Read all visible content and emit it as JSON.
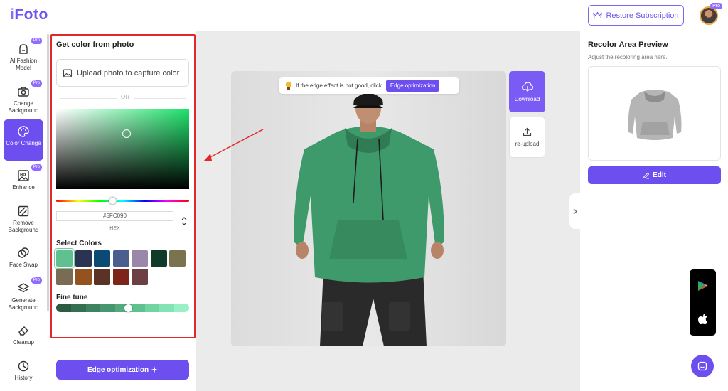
{
  "header": {
    "logo": "iFoto",
    "restore_button": "Restore Subscription",
    "avatar_badge": "Pro"
  },
  "nav": {
    "items": [
      {
        "label": "AI Fashion Model",
        "icon": "hanger-icon",
        "pro": "Pro",
        "active": false
      },
      {
        "label": "Change Background",
        "icon": "camera-icon",
        "pro": "Pro",
        "active": false
      },
      {
        "label": "Color Change",
        "icon": "palette-icon",
        "pro": "",
        "active": true
      },
      {
        "label": "Enhance",
        "icon": "hd-image-icon",
        "pro": "Pro",
        "active": false
      },
      {
        "label": "Remove Background",
        "icon": "slash-square-icon",
        "pro": "",
        "active": false
      },
      {
        "label": "Face Swap",
        "icon": "face-swap-icon",
        "pro": "",
        "active": false
      },
      {
        "label": "Generate Background",
        "icon": "layers-icon",
        "pro": "Pro",
        "active": false
      },
      {
        "label": "Cleanup",
        "icon": "eraser-icon",
        "pro": "",
        "active": false
      },
      {
        "label": "History",
        "icon": "clock-icon",
        "pro": "",
        "active": false
      }
    ]
  },
  "panel": {
    "title": "Get color from photo",
    "upload_label": "Upload photo to capture color",
    "or_text": "OR",
    "hex_value": "#5FC090",
    "hex_label": "HEX",
    "select_colors_label": "Select Colors",
    "swatches": [
      "#5fc090",
      "#2b3352",
      "#0b4a74",
      "#4a5f8e",
      "#9a88aa",
      "#0e3b2a",
      "#7a7350",
      "#7a6b55",
      "#94521e",
      "#5a3226",
      "#7e2519",
      "#6b3f44"
    ],
    "fine_tune_label": "Fine tune",
    "fine_tune_colors": [
      "#2d5a43",
      "#356e51",
      "#3f8260",
      "#48966f",
      "#52aa7e",
      "#5fc090",
      "#72d3a3",
      "#84e3b4",
      "#99f0c6"
    ],
    "edge_button": "Edge optimization"
  },
  "canvas": {
    "tip_text": "If the edge effect is not good, click",
    "tip_button": "Edge optimization",
    "download_label": "Download",
    "reupload_label": "re-upload"
  },
  "right_panel": {
    "title": "Recolor Area Preview",
    "subtitle": "Adjust the recoloring area here.",
    "edit_button": "Edit"
  },
  "colors": {
    "accent": "#6d4ff0",
    "annotation": "#e2272d",
    "garment": "#3e9a6a"
  }
}
